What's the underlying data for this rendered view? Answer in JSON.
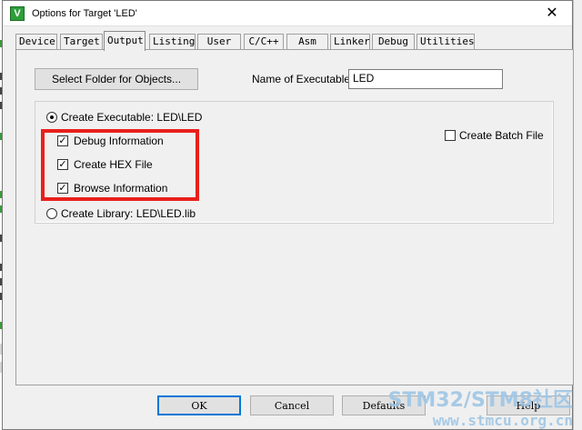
{
  "window": {
    "title": "Options for Target 'LED'",
    "icon_letter": "V",
    "close_glyph": "✕"
  },
  "tabs": [
    {
      "label": "Device",
      "active": false
    },
    {
      "label": "Target",
      "active": false
    },
    {
      "label": "Output",
      "active": true
    },
    {
      "label": "Listing",
      "active": false
    },
    {
      "label": "User",
      "active": false
    },
    {
      "label": "C/C++",
      "active": false
    },
    {
      "label": "Asm",
      "active": false
    },
    {
      "label": "Linker",
      "active": false
    },
    {
      "label": "Debug",
      "active": false
    },
    {
      "label": "Utilities",
      "active": false
    }
  ],
  "output": {
    "select_folder_label": "Select Folder for Objects...",
    "name_exec_label": "Name of Executable:",
    "name_exec_value": "LED",
    "create_exec_label": "Create Executable:  LED\\LED",
    "create_exec_selected": true,
    "debug_info_label": "Debug Information",
    "debug_info_checked": true,
    "hex_file_label": "Create HEX File",
    "hex_file_checked": true,
    "browse_info_label": "Browse Information",
    "browse_info_checked": true,
    "create_library_label": "Create Library:  LED\\LED.lib",
    "create_library_selected": false,
    "batch_file_label": "Create Batch File",
    "batch_file_checked": false,
    "check_glyph": "✓"
  },
  "footer": {
    "ok_label": "OK",
    "cancel_label": "Cancel",
    "defaults_label": "Defaults",
    "help_label": "Help"
  },
  "watermark": {
    "line1": "STM32/STM8社区",
    "line2": "www.stmcu.org.cn"
  },
  "colors": {
    "highlight": "#e8201c",
    "focus": "#0078d7",
    "watermark": "#9ec6e6"
  }
}
